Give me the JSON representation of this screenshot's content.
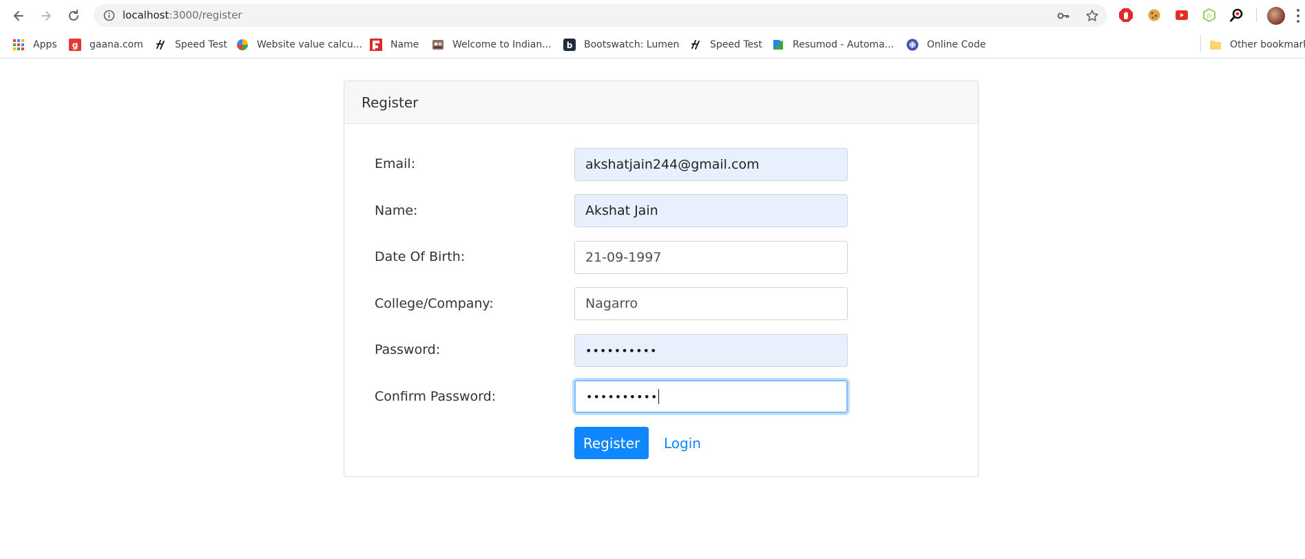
{
  "browser": {
    "url_host": "localhost",
    "url_path": ":3000/register",
    "icons": [
      "back-icon",
      "forward-icon",
      "reload-icon",
      "info-icon",
      "key-icon",
      "star-icon"
    ]
  },
  "extensions": [
    "adblock-icon",
    "cookie-icon",
    "youtube-icon",
    "nodejs-icon",
    "search-extension-icon"
  ],
  "bookmarks": {
    "items": [
      {
        "label": "Apps",
        "icon": "apps-grid-icon"
      },
      {
        "label": "gaana.com",
        "icon": "gaana-icon",
        "color": "#e53935"
      },
      {
        "label": "Speed Test",
        "icon": "speedtest-icon"
      },
      {
        "label": "Website value calcu...",
        "icon": "globe-icon"
      },
      {
        "label": "Name",
        "icon": "flipboard-icon",
        "color": "#e12828"
      },
      {
        "label": "Welcome to Indian...",
        "icon": "indian-icon"
      },
      {
        "label": "Bootswatch: Lumen",
        "icon": "bootswatch-icon"
      },
      {
        "label": "Speed Test",
        "icon": "speedtest-icon"
      },
      {
        "label": "Resumod - Automa...",
        "icon": "resumod-icon"
      },
      {
        "label": "Online Code",
        "icon": "online-code-icon"
      }
    ],
    "other_bookmarks": "Other bookmarks"
  },
  "card": {
    "title": "Register"
  },
  "form": {
    "email": {
      "label": "Email:",
      "value": "akshatjain244@gmail.com"
    },
    "name": {
      "label": "Name:",
      "value": "Akshat Jain"
    },
    "dob": {
      "label": "Date Of Birth:",
      "value": "21-09-1997"
    },
    "college": {
      "label": "College/Company:",
      "value": "Nagarro"
    },
    "password": {
      "label": "Password:",
      "value": "••••••••••"
    },
    "confirm_password": {
      "label": "Confirm Password:",
      "value": "••••••••••"
    },
    "register_label": "Register",
    "login_label": "Login"
  },
  "colors": {
    "primary": "#1087ff",
    "autofill_bg": "#e8f0fe",
    "focus_border": "#80bdff"
  }
}
